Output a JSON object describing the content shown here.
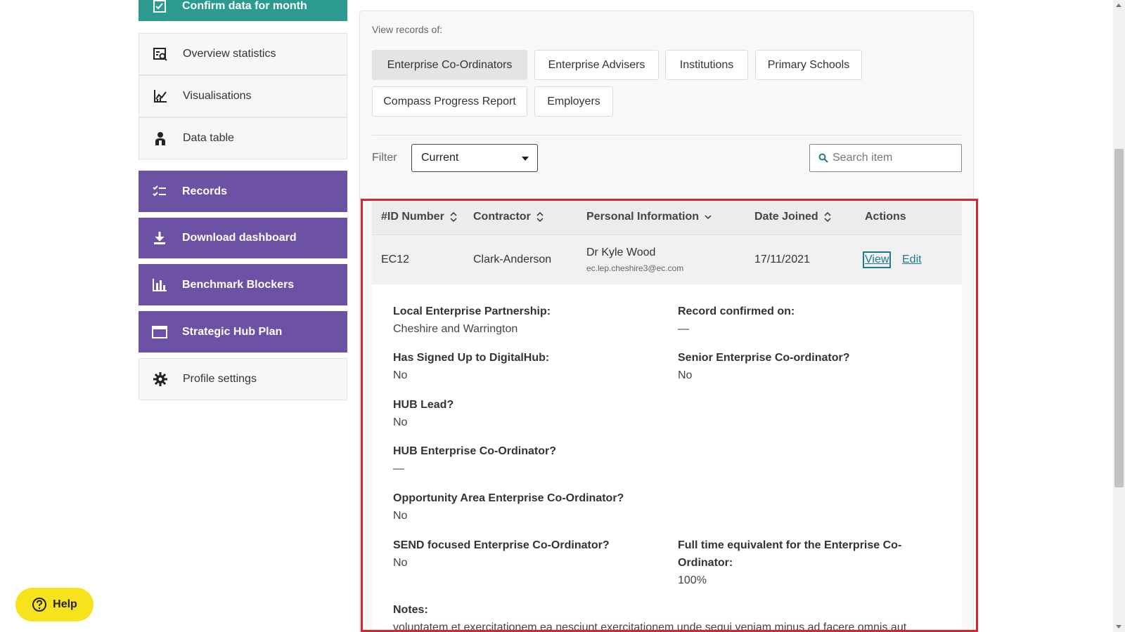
{
  "sidebar": {
    "confirm": "Confirm data for month",
    "overview": "Overview statistics",
    "visualisations": "Visualisations",
    "data_table": "Data table",
    "records": "Records",
    "download": "Download dashboard",
    "benchmark": "Benchmark Blockers",
    "hub_plan": "Strategic Hub Plan",
    "profile": "Profile settings"
  },
  "view": {
    "label": "View records of:",
    "categories": [
      "Enterprise Co-Ordinators",
      "Enterprise Advisers",
      "Institutions",
      "Primary Schools",
      "Compass Progress Report",
      "Employers"
    ],
    "active": "Enterprise Co-Ordinators"
  },
  "filter": {
    "label": "Filter",
    "selected": "Current"
  },
  "search": {
    "placeholder": "Search item"
  },
  "table": {
    "headers": {
      "id": "#ID Number",
      "contractor": "Contractor",
      "personal": "Personal Information",
      "date": "Date Joined",
      "actions": "Actions"
    },
    "row": {
      "id": "EC12",
      "contractor": "Clark-Anderson",
      "name": "Dr Kyle Wood",
      "email": "ec.lep.cheshire3@ec.com",
      "date": "17/11/2021",
      "view": "View",
      "edit": "Edit"
    }
  },
  "details": {
    "lep_label": "Local Enterprise Partnership:",
    "lep_value": "Cheshire and Warrington",
    "confirmed_label": "Record confirmed on:",
    "confirmed_value": "—",
    "digitalhub_label": "Has Signed Up to DigitalHub:",
    "digitalhub_value": "No",
    "senior_label": "Senior Enterprise Co-ordinator?",
    "senior_value": "No",
    "hublead_label": "HUB Lead?",
    "hublead_value": "No",
    "hubec_label": "HUB Enterprise Co-Ordinator?",
    "hubec_value": "—",
    "opp_label": "Opportunity Area Enterprise Co-Ordinator?",
    "opp_value": "No",
    "send_label": "SEND focused Enterprise Co-Ordinator?",
    "send_value": "No",
    "fte_label": "Full time equivalent for the Enterprise Co-Ordinator:",
    "fte_value": "100%",
    "notes_label": "Notes:",
    "notes_value": "voluptatem et exercitationem ea nesciunt exercitationem unde sequi veniam minus ad facere omnis aut"
  },
  "help": {
    "label": "Help"
  },
  "colors": {
    "purple": "#6c51a4",
    "teal": "#2b9a8f",
    "highlight": "#d8262e",
    "help": "#f7e31d",
    "link": "#1f7a8c"
  }
}
